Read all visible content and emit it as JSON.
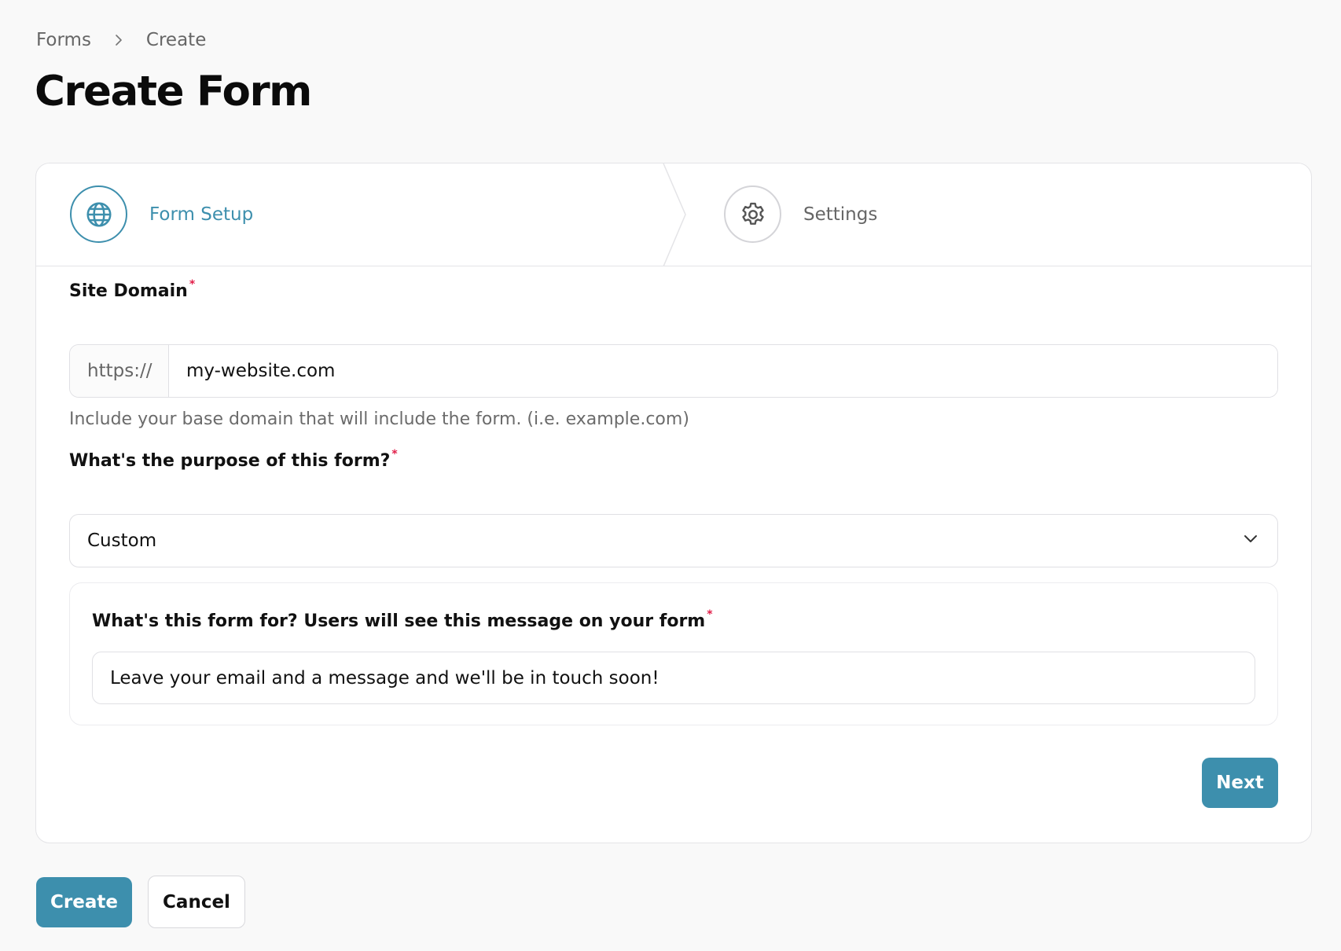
{
  "breadcrumb": {
    "items": [
      "Forms",
      "Create"
    ]
  },
  "page_title": "Create Form",
  "stepper": {
    "steps": [
      {
        "label": "Form Setup",
        "icon": "globe-icon",
        "state": "active"
      },
      {
        "label": "Settings",
        "icon": "gear-icon",
        "state": "inactive"
      }
    ]
  },
  "site_domain": {
    "label": "Site Domain",
    "required_mark": "*",
    "prefix": "https://",
    "value": "my-website.com",
    "help": "Include your base domain that will include the form. (i.e. example.com)"
  },
  "purpose": {
    "label": "What's the purpose of this form?",
    "required_mark": "*",
    "selected": "Custom"
  },
  "message": {
    "label": "What's this form for? Users will see this message on your form",
    "required_mark": "*",
    "value": "Leave your email and a message and we'll be in touch soon!"
  },
  "buttons": {
    "next": "Next",
    "create": "Create",
    "cancel": "Cancel"
  },
  "colors": {
    "accent": "#3d8fad",
    "required": "#e11d48"
  }
}
